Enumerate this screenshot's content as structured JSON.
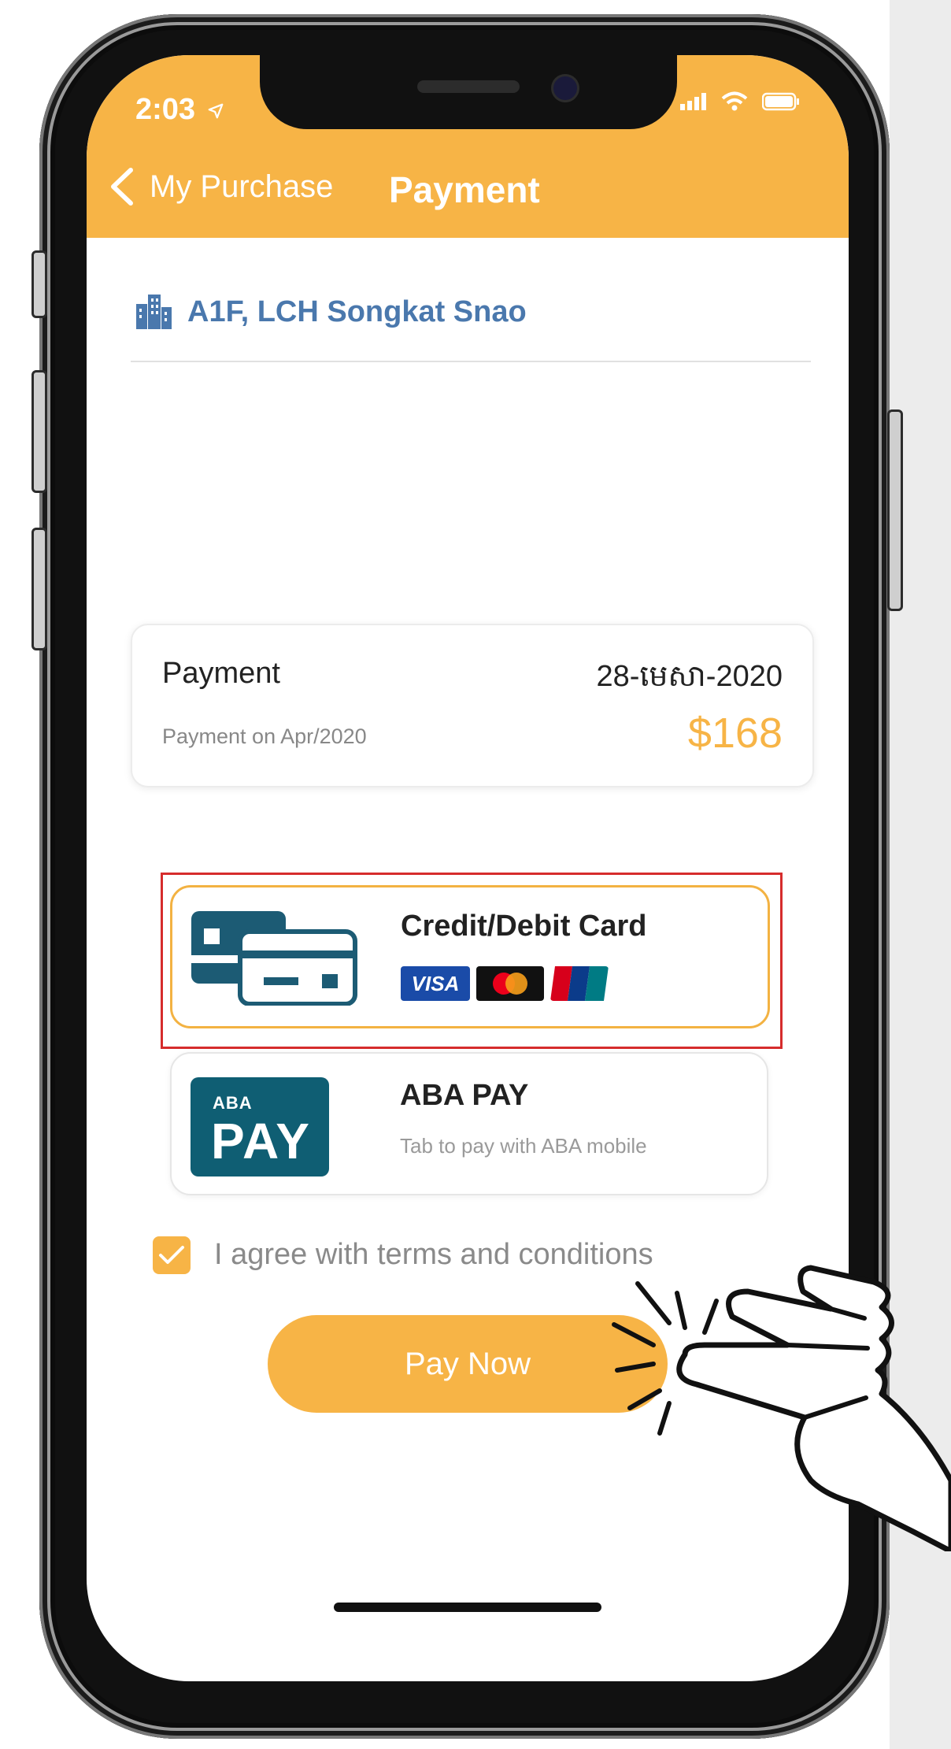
{
  "status_bar": {
    "time": "2:03",
    "location_icon": "location-arrow-icon",
    "signal_icon": "signal-icon",
    "wifi_icon": "wifi-icon",
    "battery_icon": "battery-icon"
  },
  "nav": {
    "back_label": "My Purchase",
    "title": "Payment"
  },
  "address": {
    "text": "A1F, LCH Songkat Snao",
    "icon": "building-icon"
  },
  "payment_card": {
    "label": "Payment",
    "date": "28-មេសា-2020",
    "subtitle": "Payment on Apr/2020",
    "amount": "$168"
  },
  "methods": [
    {
      "title": "Credit/Debit Card",
      "icon": "credit-card-icon",
      "logos": [
        "VISA",
        "Mastercard",
        "UnionPay"
      ]
    },
    {
      "title": "ABA PAY",
      "subtitle": "Tab to pay with ABA mobile",
      "logo_small": "ABA",
      "logo_big": "PAY"
    }
  ],
  "terms": {
    "label": "I agree with terms and conditions",
    "checked": true
  },
  "pay_button": {
    "label": "Pay Now"
  },
  "colors": {
    "accent": "#f7b446",
    "link_blue": "#4a78ad",
    "aba_teal": "#0f5e73",
    "highlight_red": "#d62c2c"
  }
}
